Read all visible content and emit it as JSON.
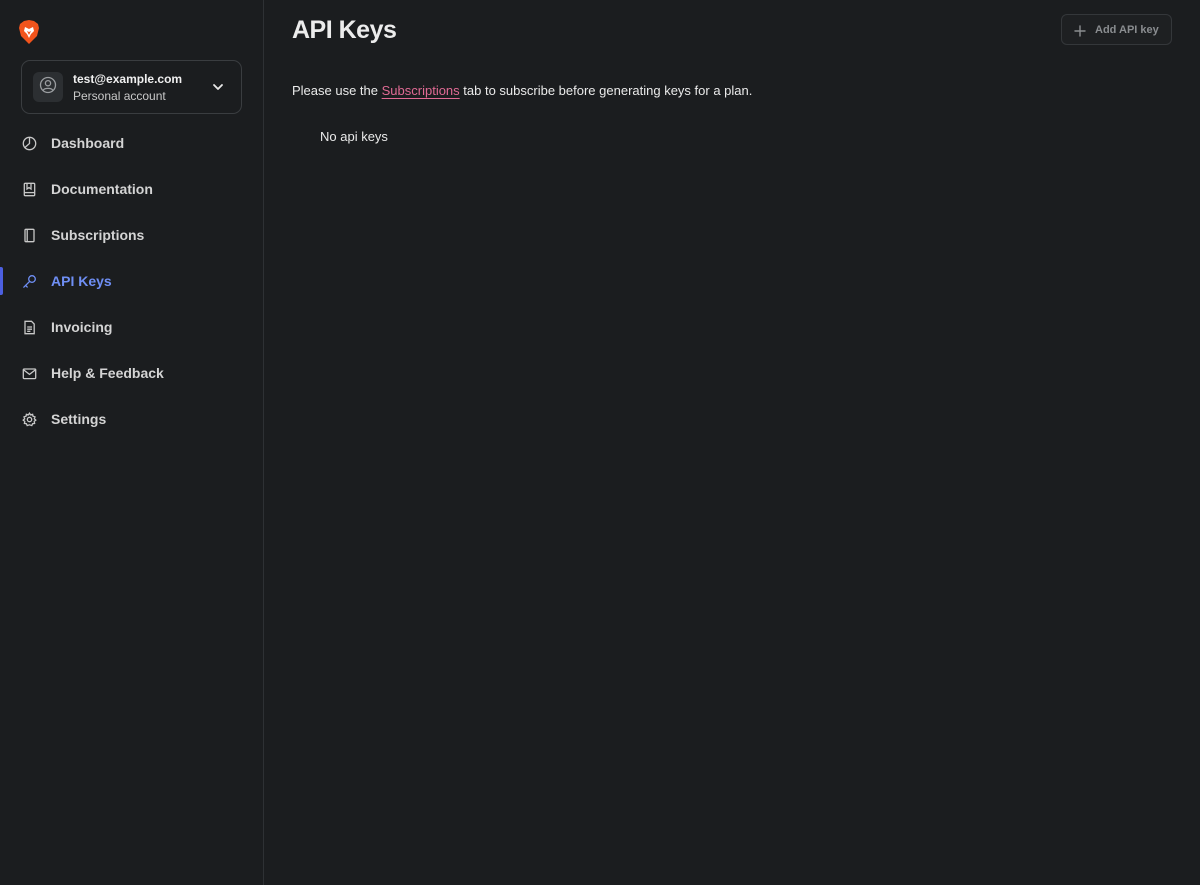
{
  "account": {
    "email": "test@example.com",
    "type": "Personal account"
  },
  "nav": [
    {
      "label": "Dashboard",
      "icon": "dashboard-icon",
      "active": false
    },
    {
      "label": "Documentation",
      "icon": "book-icon",
      "active": false
    },
    {
      "label": "Subscriptions",
      "icon": "subscription-icon",
      "active": false
    },
    {
      "label": "API Keys",
      "icon": "key-icon",
      "active": true
    },
    {
      "label": "Invoicing",
      "icon": "invoice-icon",
      "active": false
    },
    {
      "label": "Help & Feedback",
      "icon": "mail-icon",
      "active": false
    },
    {
      "label": "Settings",
      "icon": "gear-icon",
      "active": false
    }
  ],
  "main": {
    "title": "API Keys",
    "add_button": "Add API key",
    "notice_before": "Please use the ",
    "notice_link": "Subscriptions",
    "notice_after": " tab to subscribe before generating keys for a plan.",
    "empty_text": "No api keys"
  },
  "colors": {
    "background": "#1b1d1f",
    "accent": "#6f8ff5",
    "active_bar": "#4c5fe0",
    "link": "#e06a94",
    "brand": "#f2541c"
  }
}
